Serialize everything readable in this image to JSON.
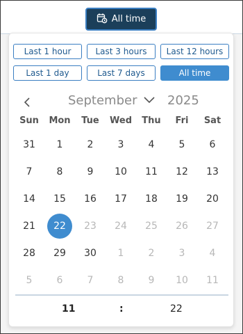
{
  "trigger": {
    "label": "All time",
    "icon": "calendar-clock-icon"
  },
  "ranges": [
    {
      "label": "Last 1 hour",
      "active": false
    },
    {
      "label": "Last 3 hours",
      "active": false
    },
    {
      "label": "Last 12 hours",
      "active": false
    },
    {
      "label": "Last 1 day",
      "active": false
    },
    {
      "label": "Last 7 days",
      "active": false
    },
    {
      "label": "All time",
      "active": true
    }
  ],
  "calendar": {
    "month": "September",
    "year": "2025",
    "weekdays": [
      "Sun",
      "Mon",
      "Tue",
      "Wed",
      "Thu",
      "Fri",
      "Sat"
    ],
    "weeks": [
      [
        "31",
        "1",
        "2",
        "3",
        "4",
        "5",
        "6"
      ],
      [
        "7",
        "8",
        "9",
        "10",
        "11",
        "12",
        "13"
      ],
      [
        "14",
        "15",
        "16",
        "17",
        "18",
        "19",
        "20"
      ],
      [
        "21",
        "22",
        "23",
        "24",
        "25",
        "26",
        "27"
      ],
      [
        "28",
        "29",
        "30",
        "1",
        "2",
        "3",
        "4"
      ],
      [
        "5",
        "6",
        "7",
        "8",
        "9",
        "10",
        "11"
      ]
    ],
    "selected_day": "22"
  },
  "time": {
    "hour": "11",
    "separator": ":",
    "minute": "22"
  },
  "colors": {
    "accent": "#3f8ccf",
    "trigger_bg": "#1b3f5a",
    "muted_text": "#b7b7b7"
  }
}
